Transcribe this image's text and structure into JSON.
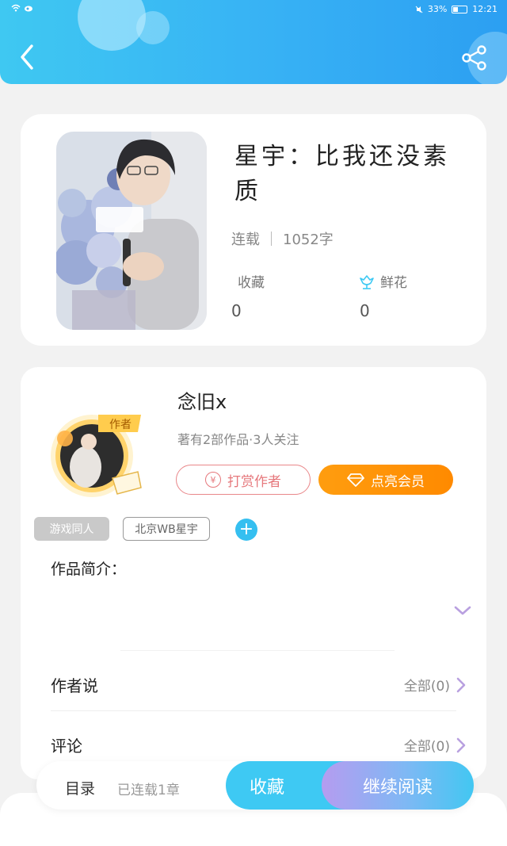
{
  "status_bar": {
    "battery": "33%",
    "time": "12:21"
  },
  "book": {
    "title": "星宇：比我还没素质",
    "status": "连载",
    "word_count": "1052字",
    "favorites_label": "收藏",
    "favorites_count": "0",
    "flowers_label": "鲜花",
    "flowers_count": "0"
  },
  "author": {
    "badge": "作者",
    "name": "念旧x",
    "summary": "著有2部作品·3人关注",
    "tip_button": "打赏作者",
    "tip_symbol": "¥",
    "vip_button": "点亮会员"
  },
  "tags": [
    "游戏同人",
    "北京WB星宇"
  ],
  "add_tag_symbol": "+",
  "intro_label": "作品简介：",
  "rows": [
    {
      "label": "作者说",
      "value": "全部(0)"
    },
    {
      "label": "评论",
      "value": "全部(0)"
    }
  ],
  "bottom_bar": {
    "toc_label": "目录",
    "toc_status": "已连载1章",
    "collect_button": "收藏",
    "read_button": "继续阅读"
  },
  "colors": {
    "header": "#37b1f4",
    "accent_blue": "#3ec9f3",
    "vip_orange": "#ff9200",
    "tip_red": "#e6787c",
    "chevron_purple": "#b9a0e0"
  }
}
